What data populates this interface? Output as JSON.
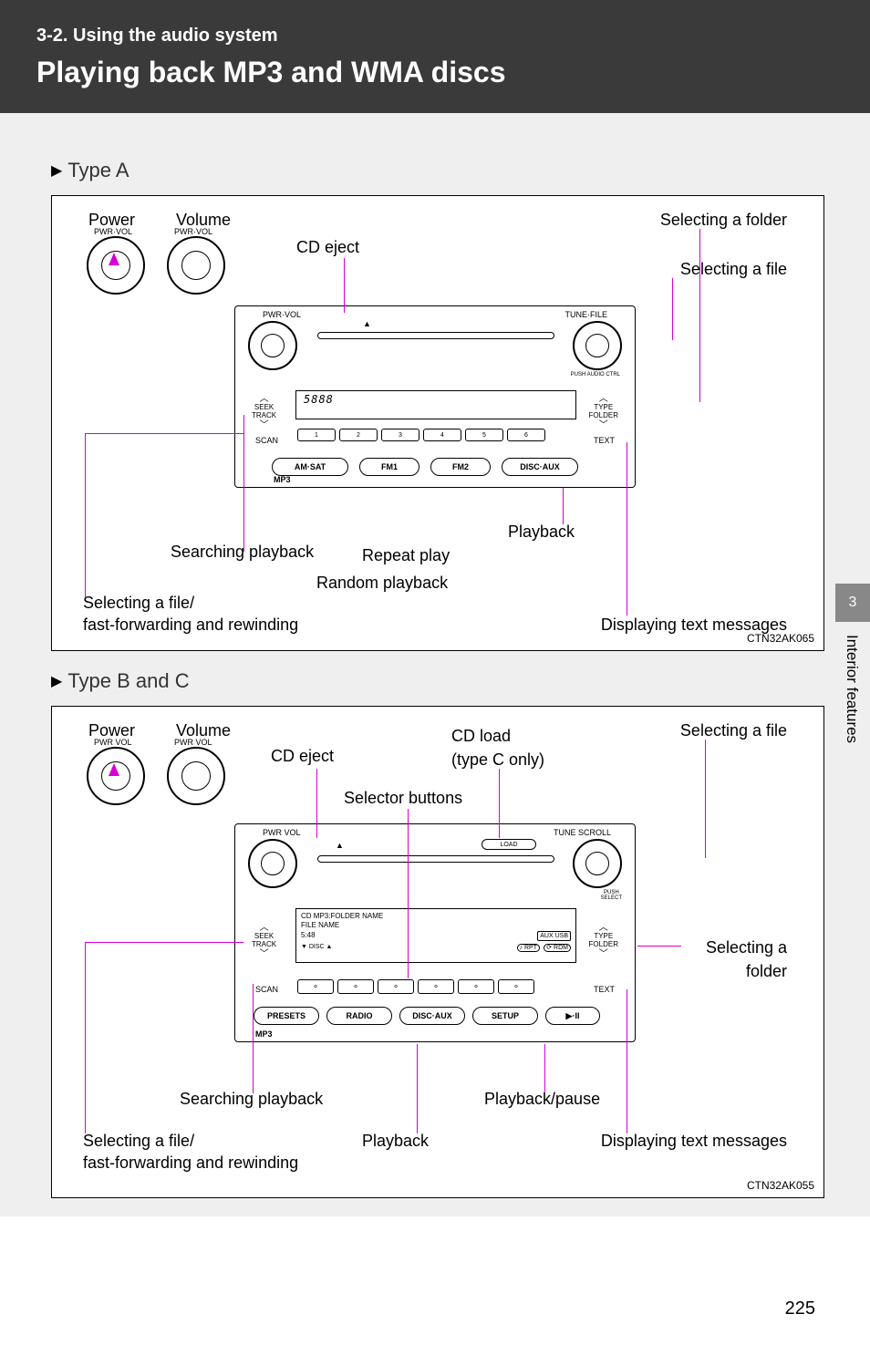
{
  "header": {
    "section": "3-2. Using the audio system",
    "title": "Playing back MP3 and WMA discs"
  },
  "type_a": {
    "heading": "Type A",
    "labels": {
      "power": "Power",
      "volume": "Volume",
      "cd_eject": "CD eject",
      "selecting_folder": "Selecting a folder",
      "selecting_file": "Selecting a file",
      "searching_playback": "Searching playback",
      "repeat_play": "Repeat play",
      "random_playback": "Random playback",
      "selecting_file_ff": "Selecting a file/",
      "ff_rewind": "fast-forwarding and rewinding",
      "playback": "Playback",
      "displaying_text": "Displaying text messages"
    },
    "unit": {
      "pwr_vol": "PWR·VOL",
      "tune_file": "TUNE·FILE",
      "seek_track": "SEEK\nTRACK",
      "type_folder": "TYPE\nFOLDER",
      "scan": "SCAN",
      "text": "TEXT",
      "am_sat": "AM·SAT",
      "fm1": "FM1",
      "fm2": "FM2",
      "disc_aux": "DISC·AUX",
      "mp3": "MP3",
      "push_audio": "PUSH AUDIO CTRL",
      "nums": [
        "1",
        "2",
        "3",
        "4",
        "5",
        "6"
      ],
      "display": "5888"
    },
    "cd_code": "CTN32AK065"
  },
  "type_bc": {
    "heading": "Type B and C",
    "labels": {
      "power": "Power",
      "volume": "Volume",
      "cd_eject": "CD eject",
      "cd_load": "CD load",
      "cd_load_sub": "(type C only)",
      "selector_buttons": "Selector buttons",
      "selecting_file": "Selecting a file",
      "selecting_folder": "Selecting a",
      "selecting_folder2": "folder",
      "searching_playback": "Searching playback",
      "playback_pause": "Playback/pause",
      "selecting_file_ff": "Selecting a file/",
      "ff_rewind": "fast-forwarding and rewinding",
      "playback": "Playback",
      "displaying_text": "Displaying text messages"
    },
    "unit": {
      "pwr_vol": "PWR VOL",
      "tune_scroll": "TUNE SCROLL",
      "push_select": "PUSH\nSELECT",
      "load": "LOAD",
      "seek_track": "SEEK\nTRACK",
      "type_folder": "TYPE\nFOLDER",
      "scan": "SCAN",
      "text": "TEXT",
      "presets": "PRESETS",
      "radio": "RADIO",
      "disc_aux": "DISC·AUX",
      "setup": "SETUP",
      "play_pause": "▶·II",
      "mp3": "MP3",
      "disc": "DISC",
      "display_line1": "CD MP3:FOLDER NAME",
      "display_line2": "FILE NAME",
      "display_line3": "5:48",
      "display_rpt": "♪ RPT",
      "display_rdm": "⟳ RDM",
      "display_aux_usb": "AUX USB"
    },
    "cd_code": "CTN32AK055"
  },
  "side": {
    "chapter_num": "3",
    "category": "Interior features"
  },
  "page_number": "225"
}
